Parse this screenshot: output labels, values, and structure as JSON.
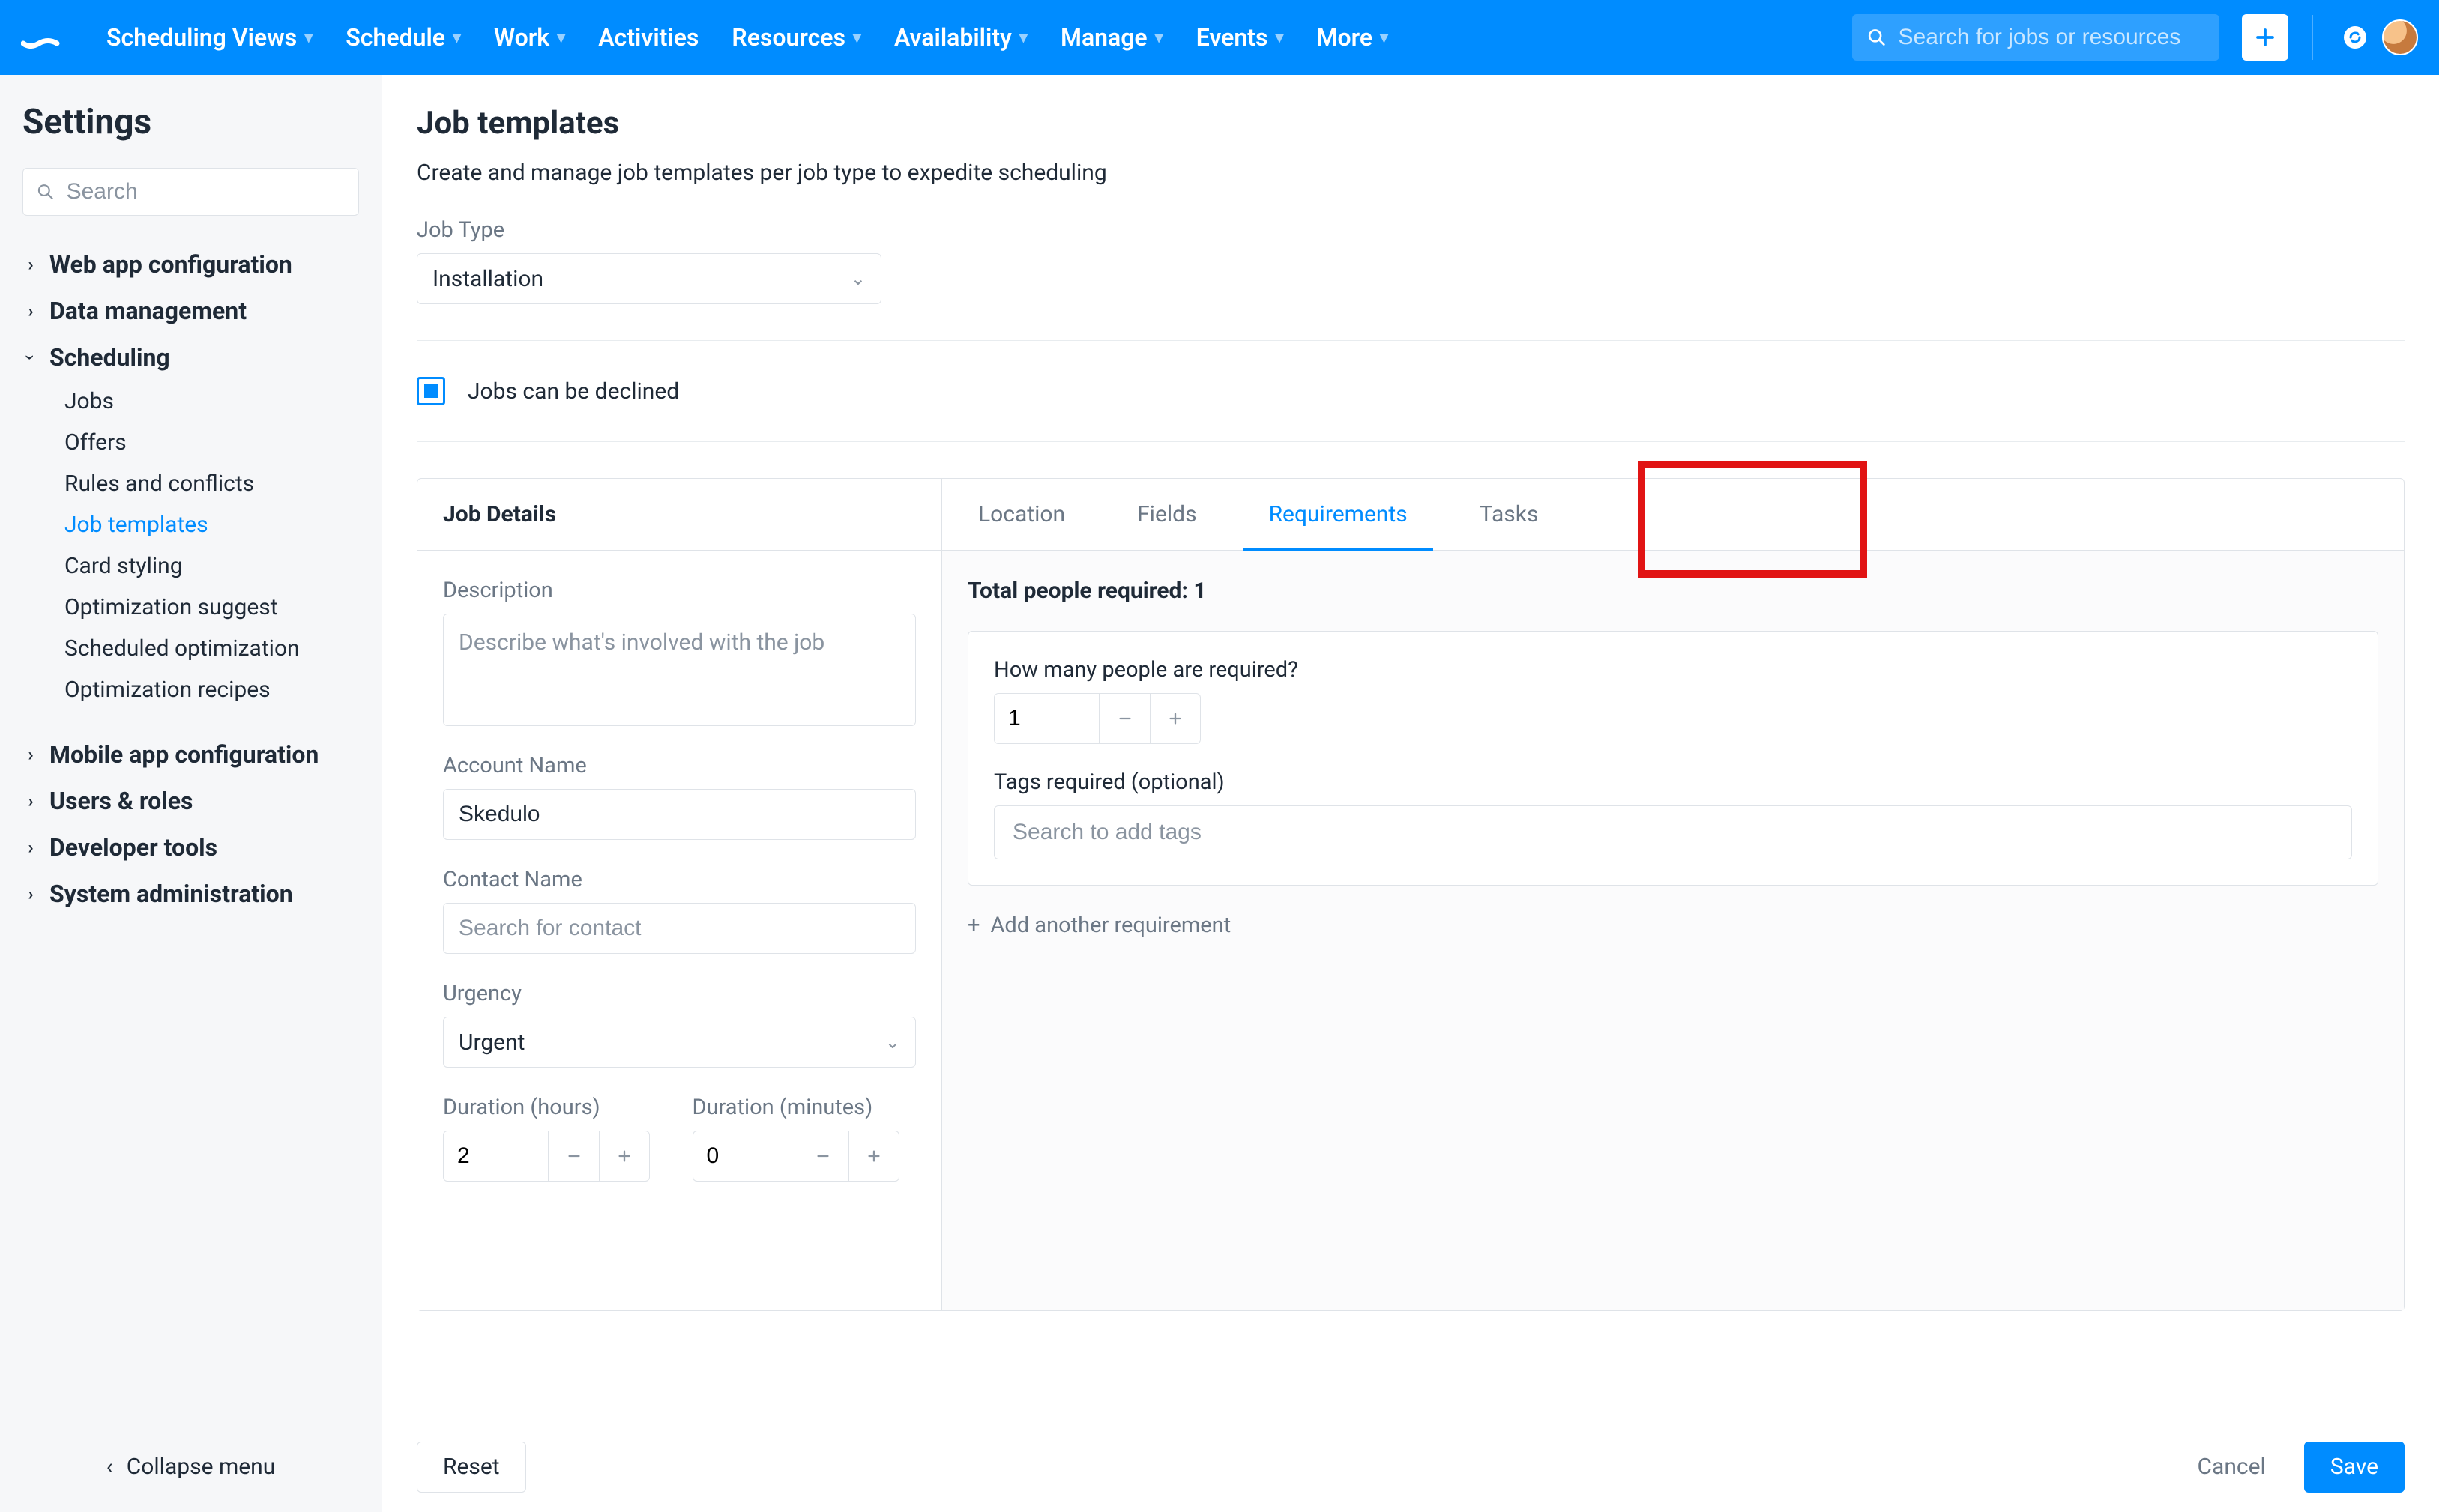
{
  "topnav": {
    "items": [
      {
        "label": "Scheduling Views",
        "caret": true
      },
      {
        "label": "Schedule",
        "caret": true
      },
      {
        "label": "Work",
        "caret": true
      },
      {
        "label": "Activities",
        "caret": false
      },
      {
        "label": "Resources",
        "caret": true
      },
      {
        "label": "Availability",
        "caret": true
      },
      {
        "label": "Manage",
        "caret": true
      },
      {
        "label": "Events",
        "caret": true
      },
      {
        "label": "More",
        "caret": true
      }
    ],
    "search_placeholder": "Search for jobs or resources"
  },
  "sidebar": {
    "title": "Settings",
    "search_placeholder": "Search",
    "groups": [
      {
        "label": "Web app configuration",
        "expanded": false
      },
      {
        "label": "Data management",
        "expanded": false
      },
      {
        "label": "Scheduling",
        "expanded": true,
        "children": [
          {
            "label": "Jobs"
          },
          {
            "label": "Offers"
          },
          {
            "label": "Rules and conflicts"
          },
          {
            "label": "Job templates",
            "active": true
          },
          {
            "label": "Card styling"
          },
          {
            "label": "Optimization suggest"
          },
          {
            "label": "Scheduled optimization"
          },
          {
            "label": "Optimization recipes"
          }
        ]
      },
      {
        "label": "Mobile app configuration",
        "expanded": false
      },
      {
        "label": "Users & roles",
        "expanded": false
      },
      {
        "label": "Developer tools",
        "expanded": false
      },
      {
        "label": "System administration",
        "expanded": false
      }
    ],
    "collapse_label": "Collapse menu"
  },
  "page": {
    "title": "Job templates",
    "subtitle": "Create and manage job templates per job type to expedite scheduling",
    "job_type_label": "Job Type",
    "job_type_value": "Installation",
    "decline_label": "Jobs can be declined",
    "tabs": {
      "primary": "Job Details",
      "items": [
        "Location",
        "Fields",
        "Requirements",
        "Tasks"
      ],
      "active": "Requirements"
    },
    "details": {
      "description_label": "Description",
      "description_placeholder": "Describe what's involved with the job",
      "account_label": "Account Name",
      "account_value": "Skedulo",
      "contact_label": "Contact Name",
      "contact_placeholder": "Search for contact",
      "urgency_label": "Urgency",
      "urgency_value": "Urgent",
      "duration_h_label": "Duration (hours)",
      "duration_h_value": "2",
      "duration_m_label": "Duration (minutes)",
      "duration_m_value": "0"
    },
    "requirements": {
      "total_label": "Total people required: 1",
      "people_label": "How many people are required?",
      "people_value": "1",
      "tags_label": "Tags required (optional)",
      "tags_placeholder": "Search to add tags",
      "add_link": "Add another requirement"
    }
  },
  "footer": {
    "reset": "Reset",
    "cancel": "Cancel",
    "save": "Save"
  }
}
